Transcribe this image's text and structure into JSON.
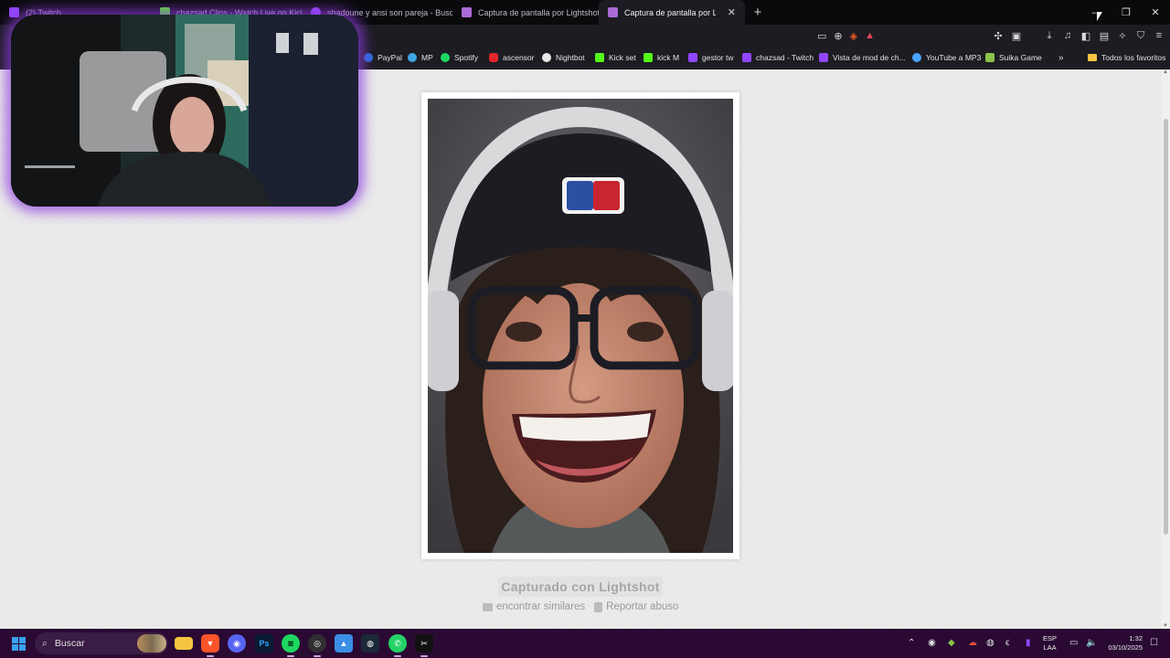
{
  "browser": {
    "tabs": [
      {
        "label": "(2) Twitch",
        "color": "#9146ff"
      },
      {
        "label": "chazsad Clips - Watch Live on Kick",
        "color": "#53fc18"
      },
      {
        "label": "shadoune y ansi son pareja - Buscar",
        "color": "#9146ff"
      },
      {
        "label": "Captura de pantalla por Lightshot",
        "color": "#a96bd6"
      },
      {
        "label": "Captura de pantalla por Lightshot",
        "color": "#a96bd6"
      }
    ],
    "active_tab_index": 4,
    "new_tab_symbol": "+",
    "window_controls": {
      "minimize": "—",
      "restore": "❐",
      "close": "✕"
    },
    "tab_close": "✕"
  },
  "toolbar": {
    "icons": [
      "cast-icon",
      "zoom-icon",
      "brave-shield-icon",
      "brave-rewards-icon",
      "extensions-icon",
      "tab-search-icon",
      "download-icon",
      "media-icon",
      "sidebar-icon",
      "wallet-icon",
      "leo-ai-icon",
      "vpn-icon",
      "menu-icon"
    ]
  },
  "bookmarks": {
    "items": [
      {
        "label": "PayPal",
        "color": "#2a6ddc"
      },
      {
        "label": "MP",
        "color": "#3fa7e6"
      },
      {
        "label": "Spotify",
        "color": "#1ed760"
      },
      {
        "label": "ascensor",
        "color": "#e3262a"
      },
      {
        "label": "Nightbot",
        "color": "#e8e8e8"
      },
      {
        "label": "Kick set",
        "color": "#53fc18"
      },
      {
        "label": "kick M",
        "color": "#53fc18"
      },
      {
        "label": "gestor tw",
        "color": "#9146ff"
      },
      {
        "label": "chazsad - Twitch",
        "color": "#9146ff"
      },
      {
        "label": "Vista de mod de ch...",
        "color": "#9146ff"
      },
      {
        "label": "YouTube a MP3",
        "color": "#4aa3ff"
      },
      {
        "label": "Suika Game",
        "color": "#8bc34a"
      }
    ],
    "more_symbol": "»",
    "all_bookmarks": "Todos los favoritos"
  },
  "page": {
    "caption": "Capturado con Lightshot",
    "find_similar": "encontrar similares",
    "report_abuse": "Reportar abuso"
  },
  "taskbar": {
    "search_placeholder": "Buscar",
    "apps": [
      "brave-icon",
      "file-explorer-icon",
      "brave-browser-icon",
      "discord-icon",
      "photoshop-icon",
      "spotify-icon",
      "obs-icon",
      "photos-icon",
      "steam-icon",
      "whatsapp-icon",
      "capcut-icon"
    ],
    "lang_top": "ESP",
    "lang_bottom": "LAA",
    "time": "1:32",
    "date": "03/10/2025"
  }
}
